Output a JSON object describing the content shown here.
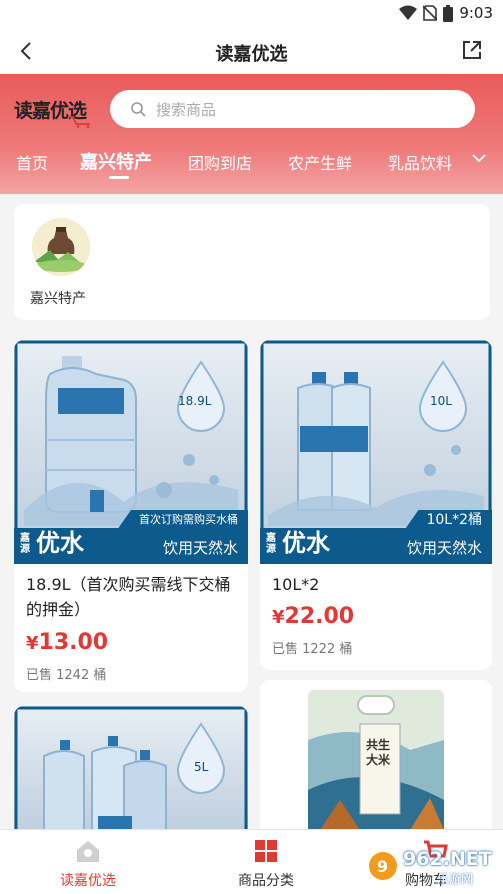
{
  "status_bar": {
    "time": "9:03"
  },
  "header": {
    "title": "读嘉优选"
  },
  "logo": {
    "text": "读嘉优选"
  },
  "search": {
    "placeholder": "搜索商品"
  },
  "tabs": [
    {
      "label": "首页"
    },
    {
      "label": "嘉兴特产",
      "active": true
    },
    {
      "label": "团购到店"
    },
    {
      "label": "农产生鲜"
    },
    {
      "label": "乳品饮料"
    }
  ],
  "categories": [
    {
      "label": "嘉兴特产"
    }
  ],
  "products": [
    {
      "name": "18.9L（首次购买需线下交桶的押金）",
      "price": "13.00",
      "currency": "¥",
      "sold": "已售 1242 桶",
      "image": {
        "volume": "18.9L",
        "ribbon": "首次订购需购买水桶",
        "brand": "优水",
        "brand_prefix": "嘉源",
        "slogan": "饮用天然水"
      }
    },
    {
      "name": "10L*2",
      "price": "22.00",
      "currency": "¥",
      "sold": "已售 1222 桶",
      "image": {
        "volume": "10L",
        "ribbon": "10L*2桶",
        "brand": "优水",
        "brand_prefix": "嘉源",
        "slogan": "饮用天然水"
      }
    },
    {
      "image": {
        "volume": "5L"
      }
    },
    {
      "image": {
        "bag_text": "共生大米"
      }
    }
  ],
  "bottom_nav": [
    {
      "label": "读嘉优选",
      "active": true
    },
    {
      "label": "商品分类"
    },
    {
      "label": "购物车"
    }
  ],
  "watermark": {
    "text": "962.NET",
    "sub": "乐游网"
  },
  "colors": {
    "accent": "#e03a36",
    "hero": "#ec6868",
    "brand_blue": "#0d5a8c"
  }
}
